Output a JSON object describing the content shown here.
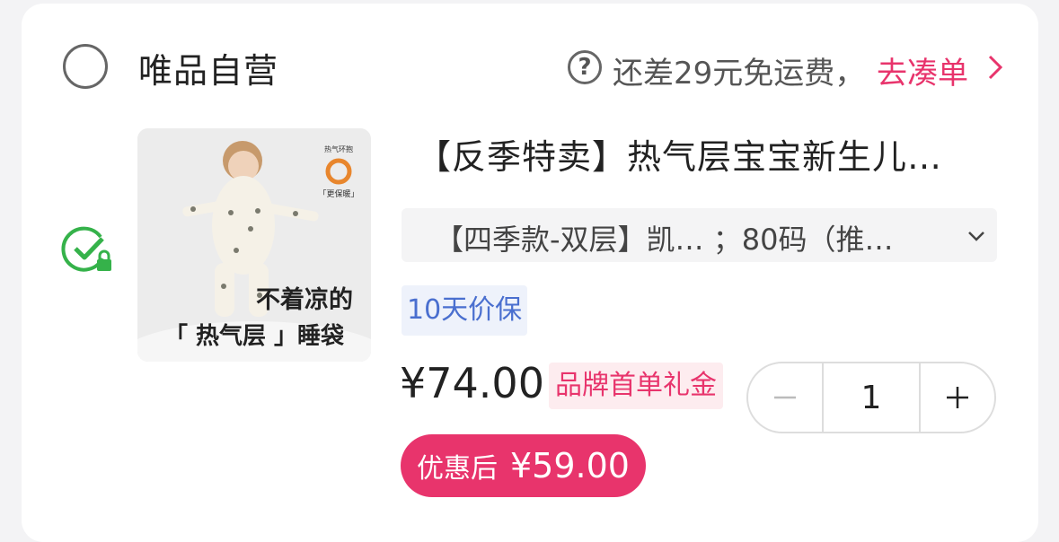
{
  "shop": {
    "name": "唯品自营",
    "shipping_notice": "还差29元免运费，",
    "shipping_link": "去凑单"
  },
  "item": {
    "title": "【反季特卖】热气层宝宝新生儿…",
    "sku": "【四季款-双层】凯…   ；80码（推…",
    "price_protect_tag": "10天价保",
    "price": "¥74.00",
    "coupon_tag": "品牌首单礼金",
    "quantity": "1",
    "final_label": "优惠后",
    "final_price": "¥59.00",
    "image_text": {
      "badge_top": "热气环抱",
      "badge_bottom": "「更保暖」",
      "line1": "不着凉的",
      "line2": "「 热气层 」睡袋"
    }
  },
  "colors": {
    "accent": "#e8346c",
    "check_green": "#35b24a",
    "tag_blue": "#4a6fcf"
  },
  "icons": {
    "help": "question-circle-icon",
    "chevron": "chevron-right-icon",
    "dropdown": "chevron-down-icon",
    "selected": "check-circle-lock-icon",
    "minus": "minus-icon",
    "plus": "plus-icon"
  }
}
